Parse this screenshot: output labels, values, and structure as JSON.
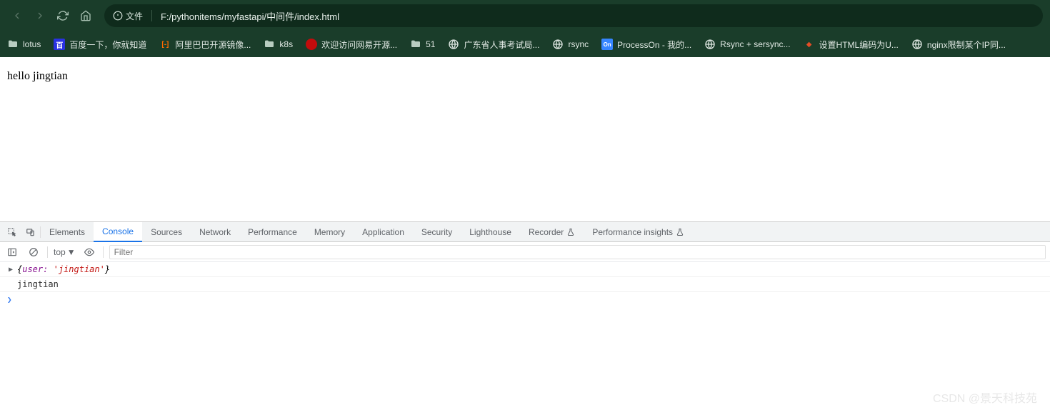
{
  "browser": {
    "url_prefix_label": "文件",
    "url": "F:/pythonitems/myfastapi/中间件/index.html"
  },
  "bookmarks": [
    {
      "label": "lotus",
      "icon_type": "folder"
    },
    {
      "label": "百度一下，你就知道",
      "icon_type": "baidu"
    },
    {
      "label": "阿里巴巴开源镜像...",
      "icon_type": "aliyun"
    },
    {
      "label": "k8s",
      "icon_type": "folder"
    },
    {
      "label": "欢迎访问网易开源...",
      "icon_type": "netease"
    },
    {
      "label": "51",
      "icon_type": "folder"
    },
    {
      "label": "广东省人事考试局...",
      "icon_type": "globe"
    },
    {
      "label": "rsync",
      "icon_type": "globe"
    },
    {
      "label": "ProcessOn - 我的...",
      "icon_type": "processon"
    },
    {
      "label": "Rsync + sersync...",
      "icon_type": "globe"
    },
    {
      "label": "设置HTML编码为U...",
      "icon_type": "html"
    },
    {
      "label": "nginx限制某个IP同...",
      "icon_type": "globe"
    }
  ],
  "page": {
    "content": "hello jingtian"
  },
  "devtools": {
    "tabs": {
      "elements": "Elements",
      "console": "Console",
      "sources": "Sources",
      "network": "Network",
      "performance": "Performance",
      "memory": "Memory",
      "application": "Application",
      "security": "Security",
      "lighthouse": "Lighthouse",
      "recorder": "Recorder",
      "perf_insights": "Performance insights"
    },
    "toolbar": {
      "context": "top",
      "filter_placeholder": "Filter"
    },
    "console": {
      "row1_key": "user:",
      "row1_val": "'jingtian'",
      "row2": "jingtian"
    }
  },
  "watermark": "CSDN @景天科技苑"
}
